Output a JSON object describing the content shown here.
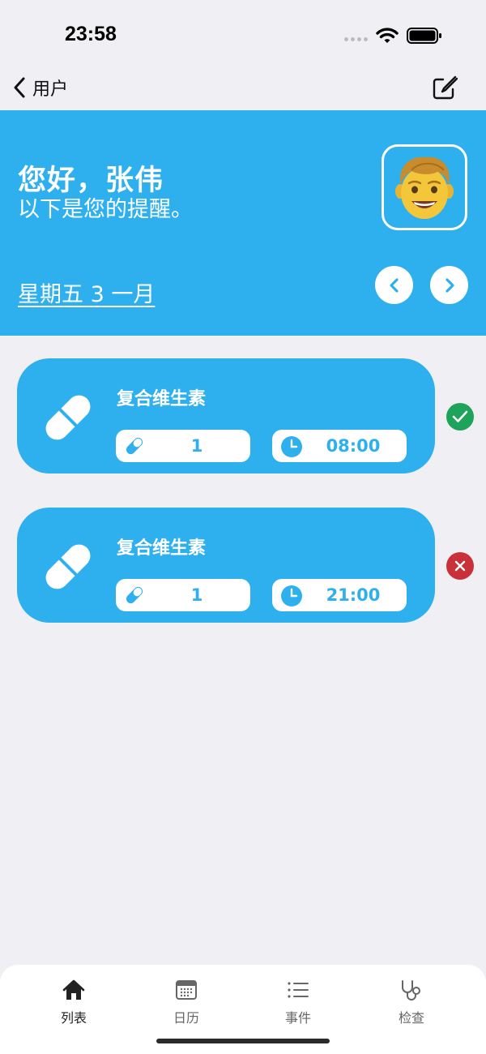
{
  "status_bar": {
    "time": "23:58"
  },
  "nav": {
    "back_label": "用户",
    "icons": {
      "back": "chevron-left-icon",
      "edit": "compose-icon"
    }
  },
  "hero": {
    "greeting": "您好，张伟",
    "subtitle": "以下是您的提醒。",
    "date": "星期五 3 一月",
    "avatar_icon": "man-emoji-avatar"
  },
  "reminders": [
    {
      "name": "复合维生素",
      "dose": "1",
      "time": "08:00",
      "status": "taken",
      "status_icon": "checkmark-icon"
    },
    {
      "name": "复合维生素",
      "dose": "1",
      "time": "21:00",
      "status": "missed",
      "status_icon": "x-icon"
    }
  ],
  "tabs": [
    {
      "label": "列表",
      "icon": "home-icon",
      "active": true
    },
    {
      "label": "日历",
      "icon": "calendar-icon",
      "active": false
    },
    {
      "label": "事件",
      "icon": "list-icon",
      "active": false
    },
    {
      "label": "检查",
      "icon": "stethoscope-icon",
      "active": false
    }
  ],
  "colors": {
    "accent": "#2fb0ee",
    "background": "#efeff4",
    "taken": "#1ea35a",
    "missed": "#c9303a"
  }
}
